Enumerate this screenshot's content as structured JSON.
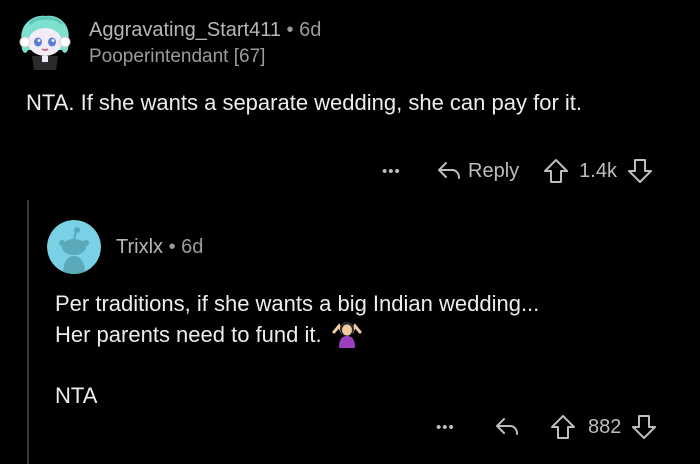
{
  "comment": {
    "username": "Aggravating_Start411",
    "separator": "•",
    "age": "6d",
    "flair": "Pooperintendant [67]",
    "body": "NTA. If she wants a separate wedding, she can pay for it.",
    "actions": {
      "more": "•••",
      "reply_label": "Reply",
      "vote_count": "1.4k"
    }
  },
  "reply": {
    "username": "Trixlx",
    "separator": "•",
    "age": "6d",
    "body_line1": "Per traditions, if she wants a big Indian wedding...",
    "body_line2": "Her parents need to fund it.",
    "body_emoji": "🤷🏻‍♀️",
    "body_para2": "NTA",
    "actions": {
      "more": "•••",
      "vote_count": "882"
    }
  },
  "icons": [
    "snoo-avatar-icon",
    "default-avatar-icon",
    "more-icon",
    "reply-arrow-icon",
    "upvote-icon",
    "downvote-icon",
    "shrug-emoji-icon"
  ],
  "colors": {
    "background": "#000000",
    "text": "#ededed",
    "meta": "#9a9a9a",
    "avatar2_bg": "#7ad0e4"
  }
}
